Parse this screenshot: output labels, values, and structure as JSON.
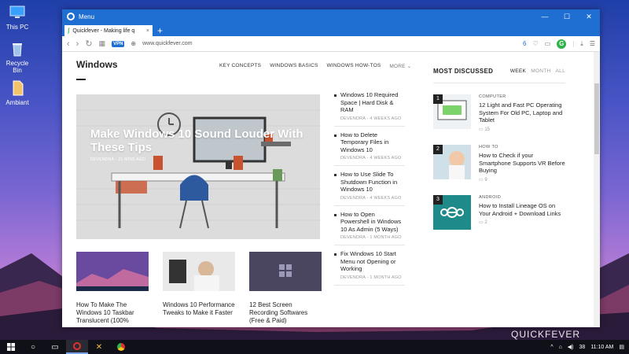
{
  "desktop": {
    "icons": [
      {
        "label": "This PC"
      },
      {
        "label": "Recycle Bin"
      },
      {
        "label": "Ambiant"
      }
    ],
    "watermark": "QUICKFEVER"
  },
  "browser": {
    "title": "Menu",
    "tab_title": "Quickfever - Making life q",
    "new_tab": "+",
    "vpn": "VPN",
    "url": "www.quickfever.com",
    "zoom": "6",
    "account_letter": "G"
  },
  "page": {
    "section_title": "Windows",
    "nav": [
      "KEY CONCEPTS",
      "WINDOWS BASICS",
      "WINDOWS HOW-TOS",
      "MORE ⌄"
    ],
    "hero": {
      "title": "Make Windows 10 Sound Louder With These Tips",
      "meta": "DEVENDRA  -  21 MINS AGO"
    },
    "cards": [
      {
        "title": "How To Make The Windows 10 Taskbar Translucent (100%"
      },
      {
        "title": "Windows 10 Performance Tweaks to Make it Faster"
      },
      {
        "title": "12 Best Screen Recording Softwares (Free & Paid)"
      }
    ],
    "mid_list": [
      {
        "title": "Windows 10 Required Space | Hard Disk & RAM",
        "meta": "DEVENDRA  -  4 WEEKS AGO"
      },
      {
        "title": "How to Delete Temporary Files in Windows 10",
        "meta": "DEVENDRA  -  4 WEEKS AGO"
      },
      {
        "title": "How to Use Slide To Shutdown Function in Windows 10",
        "meta": "DEVENDRA  -  4 WEEKS AGO"
      },
      {
        "title": "How to Open Powershell in Windows 10 As Admin (5 Ways)",
        "meta": "DEVENDRA  -  1 MONTH AGO"
      },
      {
        "title": "Fix Windows 10 Start Menu not Opening or Working",
        "meta": "DEVENDRA  -  1 MONTH AGO"
      }
    ],
    "most_discussed": {
      "title": "MOST DISCUSSED",
      "tabs": [
        "WEEK",
        "MONTH",
        "ALL"
      ],
      "items": [
        {
          "num": "1",
          "category": "COMPUTER",
          "title": "12 Light and Fast PC Operating System For Old PC, Laptop and Tablet",
          "comments": "15"
        },
        {
          "num": "2",
          "category": "HOW TO",
          "title": "How to Check if your Smartphone Supports VR Before Buying",
          "comments": "9"
        },
        {
          "num": "3",
          "category": "ANDROID",
          "title": "How to Install Lineage OS on Your Android + Download Links",
          "comments": "2"
        }
      ]
    }
  },
  "taskbar": {
    "tray_num": "38",
    "time": "11:10 AM"
  }
}
